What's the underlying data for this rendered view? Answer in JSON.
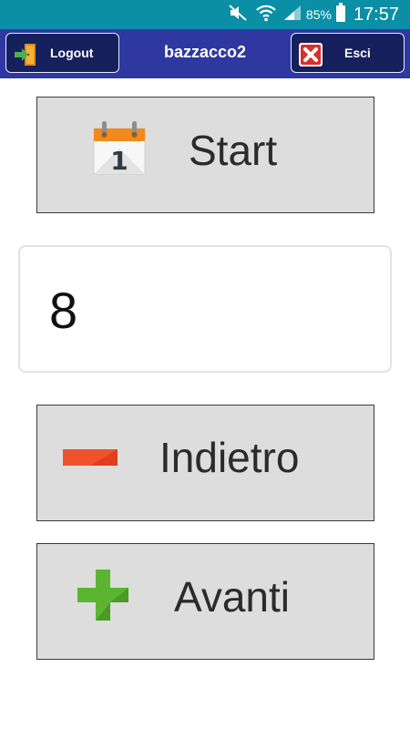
{
  "status_bar": {
    "battery_percent": "85%",
    "time": "17:57",
    "icons": [
      "mute-icon",
      "wifi-icon",
      "signal-icon",
      "battery-icon"
    ],
    "color": "#0a8fa6"
  },
  "header": {
    "logout_label": "Logout",
    "title": "bazzacco2",
    "exit_label": "Esci",
    "color": "#2e38a0"
  },
  "main": {
    "start_label": "Start",
    "value": "8",
    "back_label": "Indietro",
    "forward_label": "Avanti",
    "icons": [
      "calendar-icon",
      "minus-icon",
      "plus-icon"
    ]
  }
}
